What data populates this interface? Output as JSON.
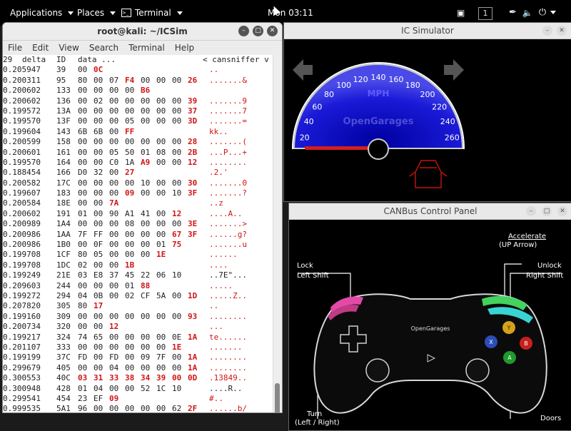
{
  "topbar": {
    "applications": "Applications",
    "places": "Places",
    "terminal": "Terminal",
    "clock": "Mon 03:11",
    "workspace": "1"
  },
  "terminal": {
    "title": "root@kali: ~/ICSim",
    "menu": [
      "File",
      "Edit",
      "View",
      "Search",
      "Terminal",
      "Help"
    ],
    "header": {
      "count": "29",
      "delta": "delta",
      "id": "ID",
      "data": "data ...",
      "cmd": "< cansniffer v"
    },
    "rows": [
      {
        "t": "0.205947",
        "id": "39",
        "b": [
          "00",
          "0C"
        ],
        "r": [
          1
        ],
        "a": ".."
      },
      {
        "t": "0.200311",
        "id": "95",
        "b": [
          "80",
          "00",
          "07",
          "F4",
          "00",
          "00",
          "00",
          "26"
        ],
        "r": [
          3,
          7
        ],
        "a": ".......&"
      },
      {
        "t": "0.200602",
        "id": "133",
        "b": [
          "00",
          "00",
          "00",
          "00",
          "B6"
        ],
        "r": [
          4
        ],
        "a": ""
      },
      {
        "t": "0.200602",
        "id": "136",
        "b": [
          "00",
          "02",
          "00",
          "00",
          "00",
          "00",
          "00",
          "39"
        ],
        "r": [
          7
        ],
        "a": ".......9"
      },
      {
        "t": "0.199572",
        "id": "13A",
        "b": [
          "00",
          "00",
          "00",
          "00",
          "00",
          "00",
          "00",
          "37"
        ],
        "r": [
          7
        ],
        "a": ".......7"
      },
      {
        "t": "0.199570",
        "id": "13F",
        "b": [
          "00",
          "00",
          "00",
          "05",
          "00",
          "00",
          "00",
          "3D"
        ],
        "r": [
          7
        ],
        "a": ".......="
      },
      {
        "t": "0.199604",
        "id": "143",
        "b": [
          "6B",
          "6B",
          "00",
          "FF"
        ],
        "r": [
          3
        ],
        "a": "kk.."
      },
      {
        "t": "0.200599",
        "id": "158",
        "b": [
          "00",
          "00",
          "00",
          "00",
          "00",
          "00",
          "00",
          "28"
        ],
        "r": [
          7
        ],
        "a": ".......("
      },
      {
        "t": "0.200601",
        "id": "161",
        "b": [
          "00",
          "00",
          "05",
          "50",
          "01",
          "08",
          "00",
          "2B"
        ],
        "r": [
          7
        ],
        "a": "...P...+"
      },
      {
        "t": "0.199570",
        "id": "164",
        "b": [
          "00",
          "00",
          "C0",
          "1A",
          "A9",
          "00",
          "00",
          "12"
        ],
        "r": [
          4,
          7
        ],
        "a": "........"
      },
      {
        "t": "0.188454",
        "id": "166",
        "b": [
          "D0",
          "32",
          "00",
          "27"
        ],
        "r": [
          3
        ],
        "a": ".2.'"
      },
      {
        "t": "0.200582",
        "id": "17C",
        "b": [
          "00",
          "00",
          "00",
          "00",
          "10",
          "00",
          "00",
          "30"
        ],
        "r": [
          7
        ],
        "a": ".......0"
      },
      {
        "t": "0.199607",
        "id": "183",
        "b": [
          "00",
          "00",
          "00",
          "09",
          "00",
          "00",
          "10",
          "3F"
        ],
        "r": [
          3,
          7
        ],
        "a": ".......?"
      },
      {
        "t": "0.200584",
        "id": "18E",
        "b": [
          "00",
          "00",
          "7A"
        ],
        "r": [
          2
        ],
        "a": "..z"
      },
      {
        "t": "0.200602",
        "id": "191",
        "b": [
          "01",
          "00",
          "90",
          "A1",
          "41",
          "00",
          "12"
        ],
        "r": [
          6
        ],
        "a": "....A.."
      },
      {
        "t": "0.200989",
        "id": "1A4",
        "b": [
          "00",
          "00",
          "00",
          "08",
          "00",
          "00",
          "00",
          "3E"
        ],
        "r": [
          7
        ],
        "a": ".......>"
      },
      {
        "t": "0.200986",
        "id": "1AA",
        "b": [
          "7F",
          "FF",
          "00",
          "00",
          "00",
          "00",
          "67",
          "3F"
        ],
        "r": [
          6,
          7
        ],
        "a": "......g?"
      },
      {
        "t": "0.200986",
        "id": "1B0",
        "b": [
          "00",
          "0F",
          "00",
          "00",
          "00",
          "01",
          "75"
        ],
        "r": [
          6
        ],
        "a": ".......u"
      },
      {
        "t": "0.199708",
        "id": "1CF",
        "b": [
          "80",
          "05",
          "00",
          "00",
          "00",
          "1E"
        ],
        "r": [
          5
        ],
        "a": "......"
      },
      {
        "t": "0.199708",
        "id": "1DC",
        "b": [
          "02",
          "00",
          "00",
          "1B"
        ],
        "r": [
          3
        ],
        "a": "...."
      },
      {
        "t": "0.199249",
        "id": "21E",
        "b": [
          "03",
          "E8",
          "37",
          "45",
          "22",
          "06",
          "10"
        ],
        "r": [],
        "a": "..7E\"..."
      },
      {
        "t": "0.209603",
        "id": "244",
        "b": [
          "00",
          "00",
          "00",
          "01",
          "88"
        ],
        "r": [
          4
        ],
        "a": "....."
      },
      {
        "t": "0.199272",
        "id": "294",
        "b": [
          "04",
          "0B",
          "00",
          "02",
          "CF",
          "5A",
          "00",
          "1D"
        ],
        "r": [
          7
        ],
        "a": ".....Z.."
      },
      {
        "t": "0.207820",
        "id": "305",
        "b": [
          "80",
          "17"
        ],
        "r": [
          1
        ],
        "a": ".."
      },
      {
        "t": "0.199160",
        "id": "309",
        "b": [
          "00",
          "00",
          "00",
          "00",
          "00",
          "00",
          "00",
          "93"
        ],
        "r": [
          7
        ],
        "a": "........"
      },
      {
        "t": "0.200734",
        "id": "320",
        "b": [
          "00",
          "00",
          "12"
        ],
        "r": [
          2
        ],
        "a": "..."
      },
      {
        "t": "0.199217",
        "id": "324",
        "b": [
          "74",
          "65",
          "00",
          "00",
          "00",
          "00",
          "0E",
          "1A"
        ],
        "r": [
          7
        ],
        "a": "te......"
      },
      {
        "t": "0.201107",
        "id": "333",
        "b": [
          "00",
          "00",
          "00",
          "00",
          "00",
          "00",
          "1E"
        ],
        "r": [
          6
        ],
        "a": "......."
      },
      {
        "t": "0.199199",
        "id": "37C",
        "b": [
          "FD",
          "00",
          "FD",
          "00",
          "09",
          "7F",
          "00",
          "1A"
        ],
        "r": [
          7
        ],
        "a": "........"
      },
      {
        "t": "0.299679",
        "id": "405",
        "b": [
          "00",
          "00",
          "04",
          "00",
          "00",
          "00",
          "00",
          "1A"
        ],
        "r": [
          7
        ],
        "a": "........"
      },
      {
        "t": "0.300553",
        "id": "40C",
        "b": [
          "03",
          "31",
          "33",
          "38",
          "34",
          "39",
          "00",
          "0D"
        ],
        "r": [
          0,
          1,
          2,
          3,
          4,
          5,
          6,
          7
        ],
        "a": ".13849.."
      },
      {
        "t": "0.300948",
        "id": "428",
        "b": [
          "01",
          "04",
          "00",
          "00",
          "52",
          "1C",
          "10"
        ],
        "r": [],
        "a": "....R.."
      },
      {
        "t": "0.299541",
        "id": "454",
        "b": [
          "23",
          "EF",
          "09"
        ],
        "r": [
          2
        ],
        "a": "#.."
      },
      {
        "t": "0.999535",
        "id": "5A1",
        "b": [
          "96",
          "00",
          "00",
          "00",
          "00",
          "00",
          "62",
          "2F"
        ],
        "r": [
          7
        ],
        "a": "......b/"
      }
    ]
  },
  "ic": {
    "title": "IC Simulator",
    "unit": "MPH",
    "brand": "OpenGarages",
    "ticks": [
      "20",
      "40",
      "60",
      "80",
      "100",
      "120",
      "140",
      "160",
      "180",
      "200",
      "220",
      "240",
      "260"
    ],
    "speed_mph": 0
  },
  "canbus": {
    "title": "CANBus Control Panel",
    "accelerate": "Accelerate",
    "accelerate_sub": "(UP Arrow)",
    "lock": "Lock",
    "lock_sub": "Left Shift",
    "unlock": "Unlock",
    "unlock_sub": "Right Shift",
    "turn": "Turn",
    "turn_sub": "(Left / Right)",
    "doors": "Doors",
    "pad_brand": "OpenGarages",
    "btn_y": "Y",
    "btn_x": "X",
    "btn_b": "B",
    "btn_a": "A"
  },
  "colors": {
    "accent_red": "#d21414",
    "gauge_blue": "#2020c0",
    "accel_green": "#44d25e",
    "unlock_cyan": "#3ad3d3",
    "lock_pink": "#e24aa8"
  }
}
